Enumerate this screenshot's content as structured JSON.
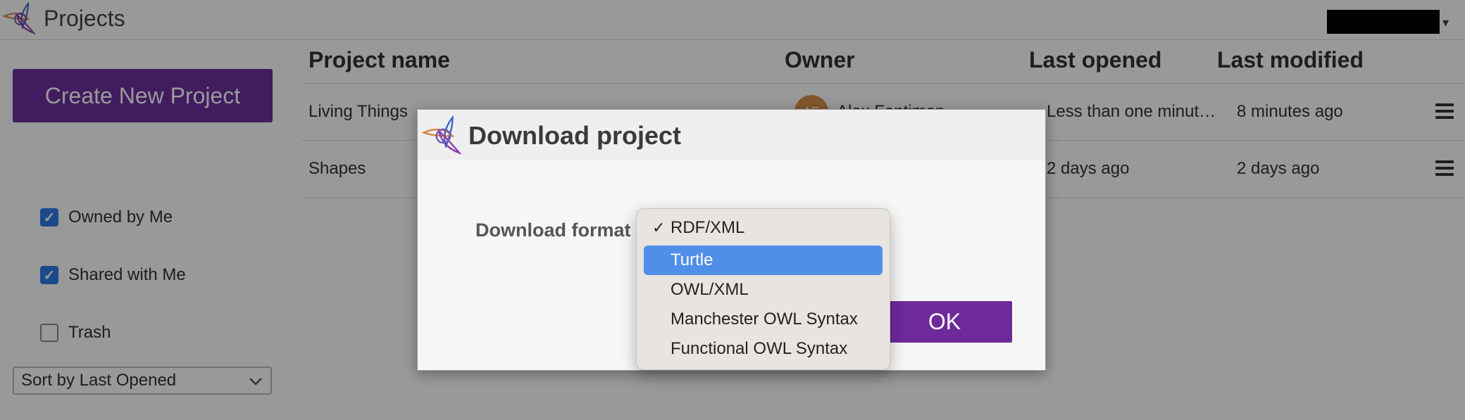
{
  "header": {
    "title": "Projects",
    "user_caret": "▾"
  },
  "sidebar": {
    "create_button": "Create New Project",
    "filters": [
      {
        "label": "Owned by Me",
        "checked": true
      },
      {
        "label": "Shared with Me",
        "checked": true
      },
      {
        "label": "Trash",
        "checked": false
      }
    ],
    "sort": {
      "selected": "Sort by Last Opened"
    }
  },
  "table": {
    "columns": [
      "Project name",
      "Owner",
      "Last opened",
      "Last modified"
    ],
    "rows": [
      {
        "name": "Living Things",
        "owner_initials": "AE",
        "owner": "Alex Fentiman",
        "last_opened": "Less than one minut…",
        "last_modified": "8 minutes ago"
      },
      {
        "name": "Shapes",
        "owner_initials": "",
        "owner": "",
        "last_opened": "2 days ago",
        "last_modified": "2 days ago"
      }
    ]
  },
  "dialog": {
    "title": "Download project",
    "format_label": "Download format",
    "ok_button": "OK",
    "format_options": [
      {
        "label": "RDF/XML",
        "checked": true,
        "highlighted": false
      },
      {
        "label": "Turtle",
        "checked": false,
        "highlighted": true
      },
      {
        "label": "OWL/XML",
        "checked": false,
        "highlighted": false
      },
      {
        "label": "Manchester OWL Syntax",
        "checked": false,
        "highlighted": false
      },
      {
        "label": "Functional OWL Syntax",
        "checked": false,
        "highlighted": false
      }
    ]
  },
  "colors": {
    "brand_purple": "#6d2f9e",
    "highlight_blue": "#4f8fe8",
    "checkbox_blue": "#2d7be6",
    "avatar_orange": "#d9934d"
  }
}
